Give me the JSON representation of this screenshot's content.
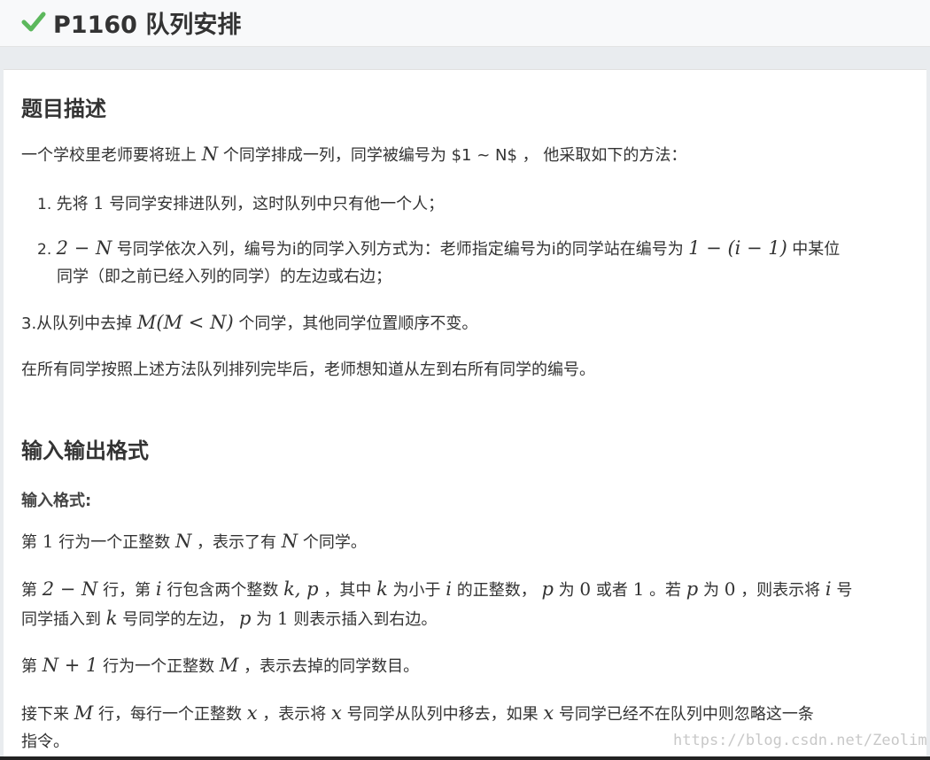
{
  "header": {
    "check_icon": "check-icon",
    "title": "P1160 队列安排"
  },
  "sections": {
    "description_title": "题目描述",
    "io_title": "输入输出格式",
    "input_format_label": "输入格式:"
  },
  "description": {
    "p1_a": "一个学校里老师要将班上",
    "p1_N": "N",
    "p1_b": "个同学排成一列，同学被编号为 $1 ~ N$ ， 他采取如下的方法：",
    "li1_num": "1.",
    "li1_a": "先将",
    "li1_one": "1",
    "li1_b": "号同学安排进队列，这时队列中只有他一个人；",
    "li2_num": "2.",
    "li2_expr": "2 − N",
    "li2_a": "号同学依次入列，编号为i的同学入列方式为：老师指定编号为i的同学站在编号为",
    "li2_expr2": "1 − (i − 1)",
    "li2_b": "中某位",
    "li2_c": "同学（即之前已经入列的同学）的左边或右边；",
    "p3_a": "3.从队列中去掉",
    "p3_expr": "M(M < N)",
    "p3_b": "个同学，其他同学位置顺序不变。",
    "p4": "在所有同学按照上述方法队列排列完毕后，老师想知道从左到右所有同学的编号。"
  },
  "input": {
    "l1_a": "第",
    "l1_one": "1",
    "l1_b": "行为一个正整数",
    "l1_N": "N",
    "l1_c": "，表示了有",
    "l1_N2": "N",
    "l1_d": "个同学。",
    "l2_a": "第",
    "l2_expr": "2 − N",
    "l2_b": "行，第",
    "l2_i": "i",
    "l2_c": "行包含两个整数",
    "l2_kp": "k, p",
    "l2_d": "，其中",
    "l2_k": "k",
    "l2_e": "为小于",
    "l2_i2": "i",
    "l2_f": "的正整数，",
    "l2_p": "p",
    "l2_g": "为",
    "l2_zero": "0",
    "l2_h": "或者",
    "l2_one": "1",
    "l2_i3": "。若",
    "l2_p2": "p",
    "l2_j": "为",
    "l2_zero2": "0",
    "l2_k2": "，则表示将",
    "l2_i4": "i",
    "l2_l": "号",
    "l3_a": "同学插入到",
    "l3_k": "k",
    "l3_b": "号同学的左边，",
    "l3_p": "p",
    "l3_c": "为",
    "l3_one": "1",
    "l3_d": "则表示插入到右边。",
    "l4_a": "第",
    "l4_expr": "N + 1",
    "l4_b": "行为一个正整数",
    "l4_M": "M",
    "l4_c": "，表示去掉的同学数目。",
    "l5_a": "接下来",
    "l5_M": "M",
    "l5_b": "行，每行一个正整数",
    "l5_x": "x",
    "l5_c": "，表示将",
    "l5_x2": "x",
    "l5_d": "号同学从队列中移去，如果",
    "l5_x3": "x",
    "l5_e": "号同学已经不在队列中则忽略这一条",
    "l6": "指令。"
  },
  "watermark": "https://blog.csdn.net/Zeolim",
  "colors": {
    "check": "#5cb85c",
    "header_bg": "#f8f9fa",
    "page_bg": "#e9ecef"
  }
}
